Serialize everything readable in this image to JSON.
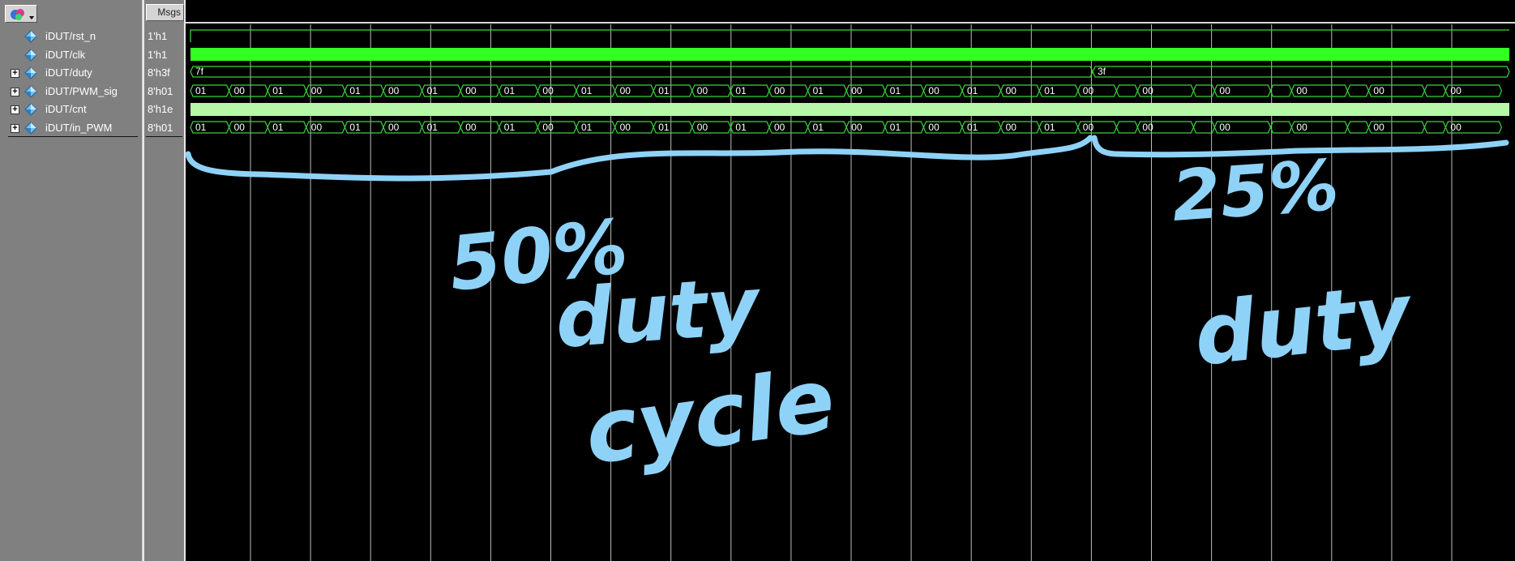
{
  "header": {
    "msgs_label": "Msgs"
  },
  "tool_button": {
    "icon": "wave-tool-icon"
  },
  "signals": [
    {
      "name": "iDUT/rst_n",
      "value": "1'h1",
      "expandable": false
    },
    {
      "name": "iDUT/clk",
      "value": "1'h1",
      "expandable": false
    },
    {
      "name": "iDUT/duty",
      "value": "8'h3f",
      "expandable": true
    },
    {
      "name": "iDUT/PWM_sig",
      "value": "8'h01",
      "expandable": true
    },
    {
      "name": "iDUT/cnt",
      "value": "8'h1e",
      "expandable": true
    },
    {
      "name": "iDUT/in_PWM",
      "value": "8'h01",
      "expandable": true
    }
  ],
  "waveform": {
    "colors": {
      "bright": "#33ff22",
      "line": "#39d43a",
      "pale": "#b6f7a8",
      "grid": "#bdbdbd",
      "text": "#ffffff"
    },
    "duty_labels": [
      "7f",
      "3f"
    ],
    "pwm_first_half": [
      "01",
      "00",
      "01",
      "00",
      "01",
      "00",
      "01",
      "00",
      "01",
      "00",
      "01",
      "00",
      "01",
      "00",
      "01",
      "00",
      "01",
      "00",
      "01",
      "00",
      "01",
      "00",
      "01",
      "00"
    ],
    "pwm_second_half": [
      "00",
      "00",
      "00",
      "00",
      "00"
    ]
  },
  "annotations": {
    "left_label": [
      "50%",
      "duty",
      "cycle"
    ],
    "right_label": [
      "25%",
      "duty"
    ],
    "ink_color": "#8fd2f7"
  }
}
